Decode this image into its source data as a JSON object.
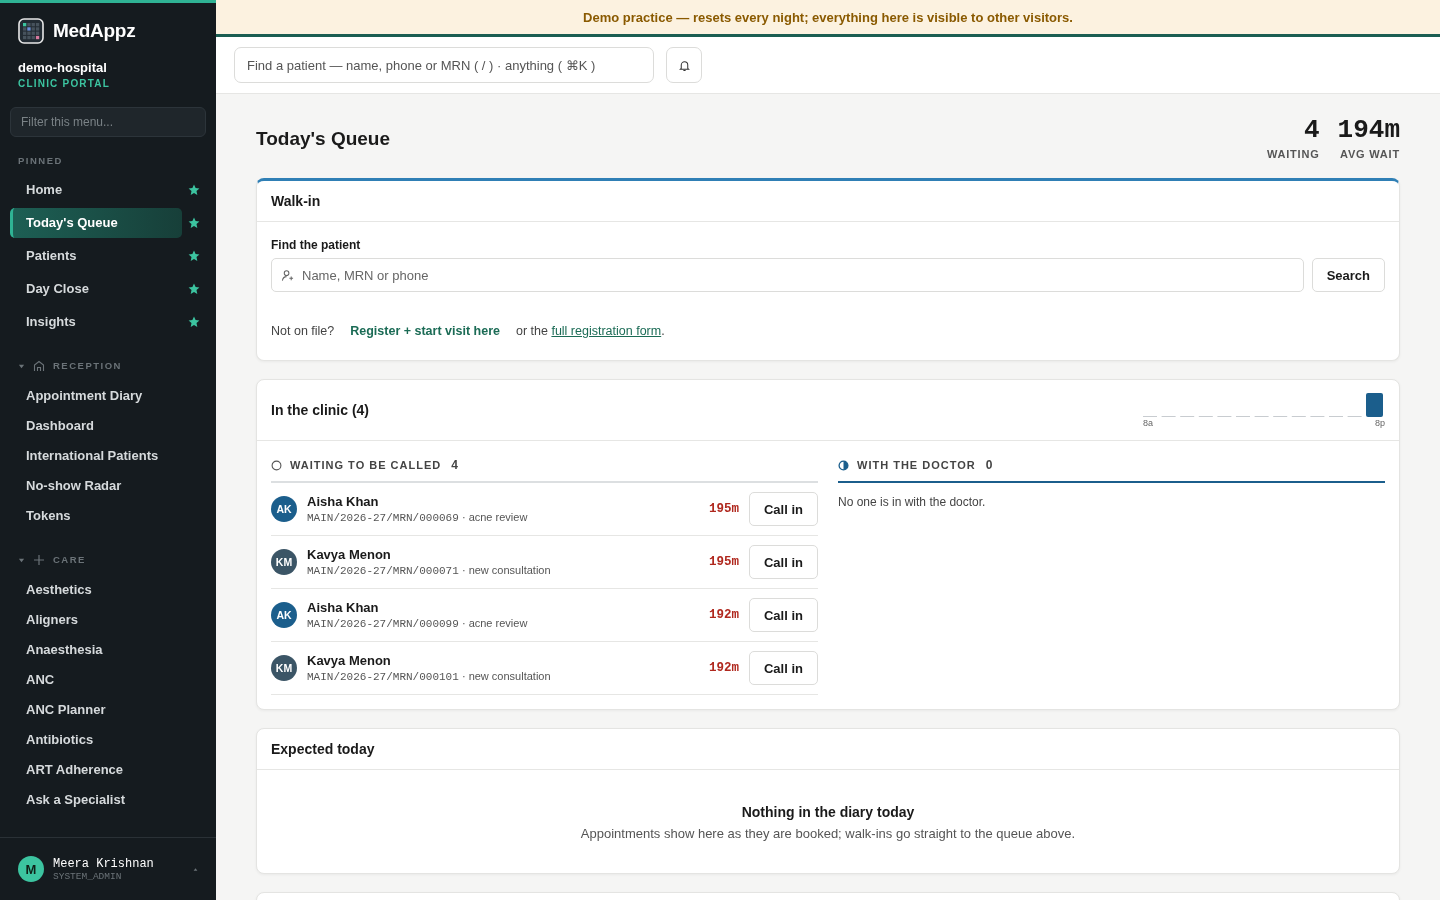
{
  "brand": {
    "name": "MedAppz"
  },
  "org": {
    "name": "demo-hospital",
    "subtitle": "CLINIC PORTAL"
  },
  "menu_filter": {
    "placeholder": "Filter this menu..."
  },
  "pinned": {
    "label": "PINNED",
    "items": [
      {
        "label": "Home",
        "selected": false
      },
      {
        "label": "Today's Queue",
        "selected": true
      },
      {
        "label": "Patients",
        "selected": false
      },
      {
        "label": "Day Close",
        "selected": false
      },
      {
        "label": "Insights",
        "selected": false
      }
    ]
  },
  "sections": [
    {
      "label": "RECEPTION",
      "expanded": true,
      "items": [
        "Appointment Diary",
        "Dashboard",
        "International Patients",
        "No-show Radar",
        "Tokens"
      ]
    },
    {
      "label": "CARE",
      "expanded": true,
      "items": [
        "Aesthetics",
        "Aligners",
        "Anaesthesia",
        "ANC",
        "ANC Planner",
        "Antibiotics",
        "ART Adherence",
        "Ask a Specialist"
      ]
    }
  ],
  "user": {
    "initial": "M",
    "name": "Meera Krishnan",
    "role": "SYSTEM_ADMIN"
  },
  "banner": "Demo practice — resets every night; everything here is visible to other visitors.",
  "search": {
    "placeholder": "Find a patient — name, phone or MRN ( / ) · anything ( ⌘K )"
  },
  "page": {
    "title": "Today's Queue",
    "stats": [
      {
        "value": "4",
        "label": "WAITING"
      },
      {
        "value": "194m",
        "label": "AVG WAIT"
      }
    ]
  },
  "walk_in": {
    "title": "Walk-in",
    "field_label": "Find the patient",
    "placeholder": "Name, MRN or phone",
    "button": "Search",
    "not_on_file": "Not on file?",
    "register_link": "Register + start visit here",
    "alt_before": "or the ",
    "alt_link": "full registration form",
    "alt_after": "."
  },
  "clinic": {
    "title": "In the clinic (4)",
    "hours_start": "8a",
    "hours_end": "8p",
    "columns": [
      {
        "kind": "waiting",
        "label": "WAITING TO BE CALLED",
        "count": "4",
        "patients": [
          {
            "initials": "AK",
            "color": "#1b5e8c",
            "name": "Aisha Khan",
            "mrn": "MAIN/2026-27/MRN/000069",
            "separator": "·",
            "reason": "acne review",
            "wait": "195m",
            "action": "Call in"
          },
          {
            "initials": "KM",
            "color": "#3b5566",
            "name": "Kavya Menon",
            "mrn": "MAIN/2026-27/MRN/000071",
            "separator": "·",
            "reason": "new consultation",
            "wait": "195m",
            "action": "Call in"
          },
          {
            "initials": "AK",
            "color": "#1b5e8c",
            "name": "Aisha Khan",
            "mrn": "MAIN/2026-27/MRN/000099",
            "separator": "·",
            "reason": "acne review",
            "wait": "192m",
            "action": "Call in"
          },
          {
            "initials": "KM",
            "color": "#3b5566",
            "name": "Kavya Menon",
            "mrn": "MAIN/2026-27/MRN/000101",
            "separator": "·",
            "reason": "new consultation",
            "wait": "192m",
            "action": "Call in"
          }
        ]
      },
      {
        "kind": "with_doctor",
        "label": "WITH THE DOCTOR",
        "count": "0",
        "empty": "No one is in with the doctor."
      }
    ]
  },
  "expected": {
    "title": "Expected today",
    "empty_title": "Nothing in the diary today",
    "empty_text": "Appointments show here as they are booked; walk-ins go straight to the queue above."
  }
}
